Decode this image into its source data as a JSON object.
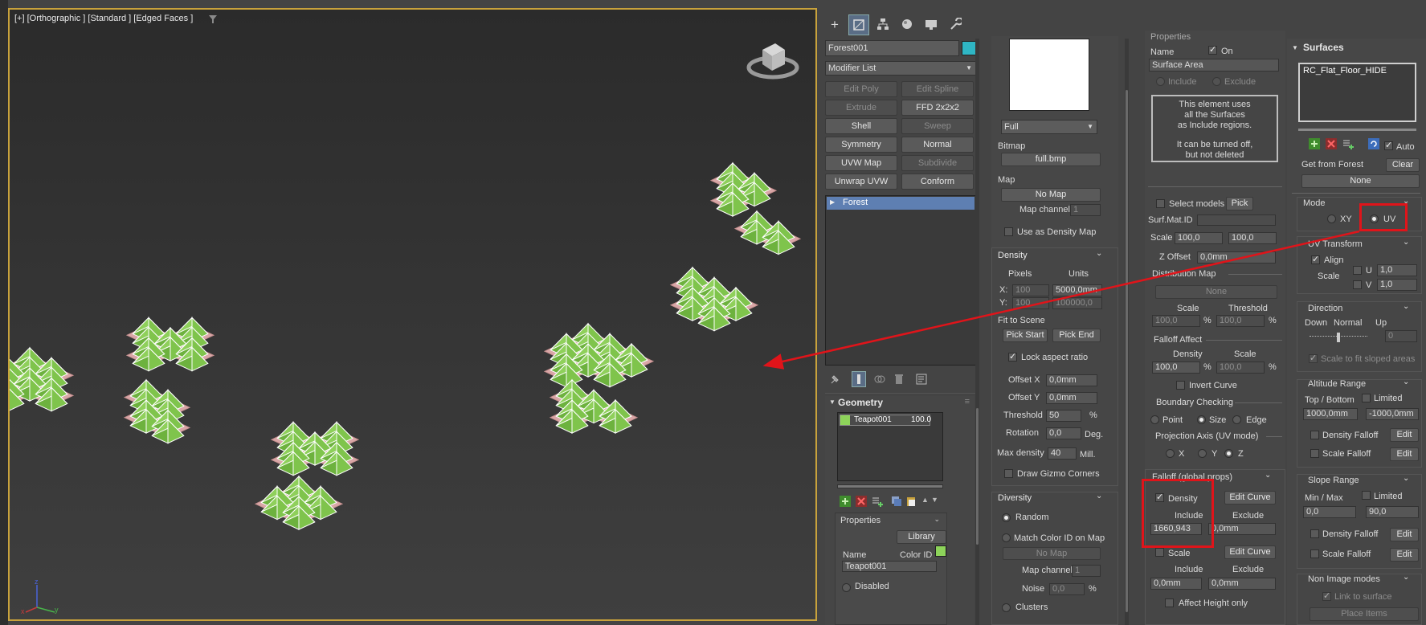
{
  "viewport": {
    "label": "[+] [Orthographic ] [Standard ] [Edged Faces ]"
  },
  "create_panel": {
    "object_name": "Forest001",
    "object_color": "#2fb6c4",
    "modifier_list": "Modifier List",
    "buttons": [
      {
        "label": "Edit Poly",
        "enabled": false
      },
      {
        "label": "Edit Spline",
        "enabled": false
      },
      {
        "label": "Extrude",
        "enabled": false
      },
      {
        "label": "FFD 2x2x2",
        "enabled": true
      },
      {
        "label": "Shell",
        "enabled": true
      },
      {
        "label": "Sweep",
        "enabled": false
      },
      {
        "label": "Symmetry",
        "enabled": true
      },
      {
        "label": "Normal",
        "enabled": true
      },
      {
        "label": "UVW Map",
        "enabled": true
      },
      {
        "label": "Subdivide",
        "enabled": false
      },
      {
        "label": "Unwrap UVW",
        "enabled": true
      },
      {
        "label": "Conform",
        "enabled": true
      }
    ],
    "stack_item": "Forest",
    "geometry": {
      "title": "Geometry",
      "item_name": "Teapot001",
      "item_value": "100.0",
      "item_color": "#8dd35a",
      "properties_title": "Properties",
      "library_btn": "Library",
      "name_label": "Name",
      "color_id_label": "Color ID",
      "name_value": "Teapot001",
      "disabled_label": "Disabled"
    }
  },
  "col2": {
    "mode_select": "Full",
    "bitmap_label": "Bitmap",
    "bitmap_btn": "full.bmp",
    "map_label": "Map",
    "map_btn": "No Map",
    "map_channel_label": "Map channel",
    "map_channel_value": "1",
    "density_map_label": "Use as Density Map",
    "density": {
      "title": "Density",
      "pixels": "Pixels",
      "units": "Units",
      "x_label": "X:",
      "x_px": "100",
      "x_units": "5000,0mm",
      "y_label": "Y:",
      "y_px": "100",
      "y_units": "100000,0",
      "fit_label": "Fit to Scene",
      "pick_start": "Pick Start",
      "pick_end": "Pick End",
      "lock_aspect": "Lock aspect ratio",
      "offset_x_label": "Offset X",
      "offset_x": "0,0mm",
      "offset_y_label": "Offset Y",
      "offset_y": "0,0mm",
      "threshold_label": "Threshold",
      "threshold": "50",
      "threshold_unit": "%",
      "rotation_label": "Rotation",
      "rotation": "0,0",
      "rotation_unit": "Deg.",
      "max_density_label": "Max density",
      "max_density": "40",
      "max_density_unit": "Mill.",
      "gizmo_label": "Draw Gizmo Corners"
    },
    "diversity": {
      "title": "Diversity",
      "random": "Random",
      "match_color": "Match Color ID on Map",
      "no_map": "No Map",
      "map_channel_label": "Map channel",
      "map_channel": "1",
      "noise_label": "Noise",
      "noise": "0,0",
      "noise_unit": "%",
      "clusters": "Clusters"
    }
  },
  "col3": {
    "prop_title": "Properties",
    "name_label": "Name",
    "on_label": "On",
    "name_value": "Surface Area",
    "include": "Include",
    "exclude": "Exclude",
    "info1": "This element uses",
    "info2": "all the Surfaces",
    "info3": "as Include regions.",
    "info4": "It can be turned off,",
    "info5": "but not deleted",
    "select_models": "Select models",
    "pick": "Pick",
    "surf_mat_id": "Surf.Mat.ID",
    "scale_label": "Scale",
    "scale1": "100,0",
    "scale2": "100,0",
    "z_offset_label": "Z Offset",
    "z_offset": "0,0mm",
    "distribution_title": "Distribution Map",
    "none_btn": "None",
    "dist_scale": "Scale",
    "dist_threshold": "Threshold",
    "dist_scale_val": "100,0",
    "dist_threshold_val": "100,0",
    "pct": "%",
    "falloff_affect": "Falloff Affect",
    "fa_density": "Density",
    "fa_scale": "Scale",
    "fa_density_val": "100,0",
    "fa_scale_val": "100,0",
    "invert_curve": "Invert Curve",
    "boundary_title": "Boundary Checking",
    "b_point": "Point",
    "b_size": "Size",
    "b_edge": "Edge",
    "projection_title": "Projection Axis (UV mode)",
    "p_x": "X",
    "p_y": "Y",
    "p_z": "Z",
    "falloff_title": "Falloff (global props)",
    "f_density": "Density",
    "edit_curve": "Edit Curve",
    "f_include": "Include",
    "f_exclude": "Exclude",
    "f_include_val": "1660,943",
    "f_exclude_val": "0,0mm",
    "f_scale": "Scale",
    "f_include_val2": "0,0mm",
    "f_exclude_val2": "0,0mm",
    "affect_height": "Affect Height only"
  },
  "col4": {
    "title": "Surfaces",
    "list_item": "RC_Flat_Floor_HIDE",
    "auto": "Auto",
    "get_from": "Get from Forest",
    "clear": "Clear",
    "none": "None",
    "mode_title": "Mode",
    "xy": "XY",
    "uv": "UV",
    "uv_transform": "UV Transform",
    "align": "Align",
    "scale": "Scale",
    "u": "U",
    "v": "V",
    "u_val": "1,0",
    "v_val": "1,0",
    "direction": "Direction",
    "down": "Down",
    "normal": "Normal",
    "up": "Up",
    "dir_val": "0",
    "scale_fit": "Scale to fit sloped areas",
    "altitude": "Altitude Range",
    "top_bottom": "Top / Bottom",
    "limited": "Limited",
    "alt_top": "1000,0mm",
    "alt_bottom": "-1000,0mm",
    "density_falloff": "Density Falloff",
    "scale_falloff": "Scale Falloff",
    "edit": "Edit",
    "slope": "Slope Range",
    "min_max": "Min / Max",
    "slope_min": "0,0",
    "slope_max": "90,0",
    "non_image": "Non Image modes",
    "link_surface": "Link to surface",
    "place_items": "Place Items"
  }
}
